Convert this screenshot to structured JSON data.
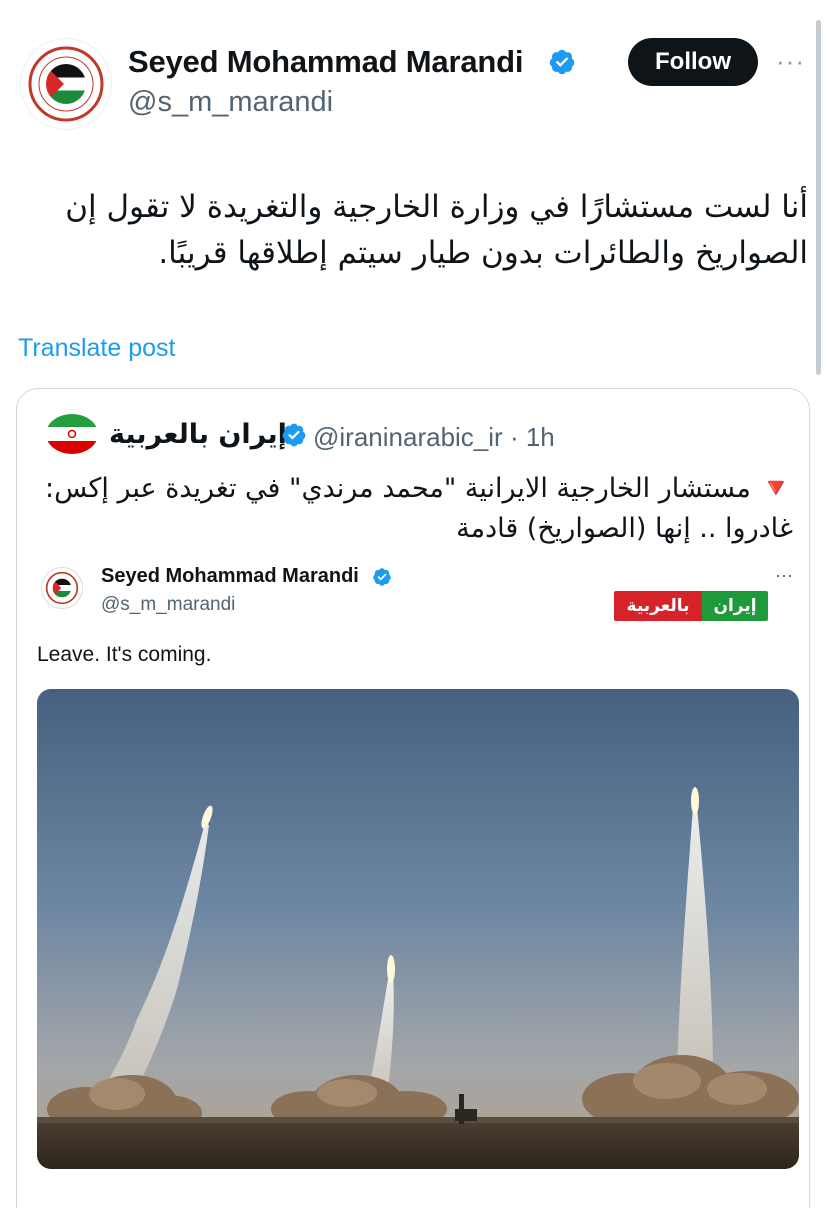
{
  "author": {
    "name": "Seyed Mohammad Marandi",
    "handle": "@s_m_marandi",
    "verified": true
  },
  "header": {
    "follow_label": "Follow",
    "more_label": "···"
  },
  "tweet": {
    "text": "أنا لست مستشارًا في وزارة الخارجية والتغريدة لا تقول إن الصواريخ والطائرات بدون طيار سيتم إطلاقها قريبًا.",
    "translate_label": "Translate post"
  },
  "quote": {
    "name": "إيران بالعربية",
    "handle": "@iraninarabic_ir",
    "separator": "·",
    "time": "1h",
    "text": "🔻 مستشار الخارجية الايرانية \"محمد مرندي\" في تغريدة عبر إكس: غادروا .. إنها (الصواريخ) قادمة"
  },
  "embedded": {
    "name": "Seyed Mohammad Marandi",
    "handle": "@s_m_marandi",
    "more_label": "···",
    "logo_red": "بالعربية",
    "logo_green": "إيران",
    "text": "Leave. It's coming."
  },
  "colors": {
    "link": "#1d9bf0",
    "verified": "#1d9bf0",
    "follow_bg": "#0f1419"
  }
}
